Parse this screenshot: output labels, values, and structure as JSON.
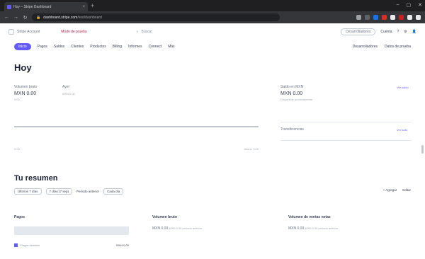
{
  "browser": {
    "tab_title": "Hoy – Stripe Dashboard",
    "url_host": "dashboard.stripe.com",
    "url_path": "/test/dashboard",
    "new_tab": "+",
    "controls": [
      "–",
      "▢",
      "✕"
    ]
  },
  "topbar": {
    "account": "Stripe Account",
    "test_mode": "Modo de prueba",
    "search_placeholder": "Buscar",
    "dev_pill": "Desarrolladores",
    "account_label": "Cuenta"
  },
  "nav": {
    "items": [
      "Inicio",
      "Pagos",
      "Saldos",
      "Clientes",
      "Productos",
      "Billing",
      "Informes",
      "Connect",
      "Más"
    ],
    "right": [
      "Desarrolladores",
      "Datos de prueba"
    ]
  },
  "page_title": "Hoy",
  "stats": {
    "gross": {
      "label": "Volumen bruto",
      "value": "MXN 0.00",
      "sub": "0:00"
    },
    "yesterday": {
      "label": "Ayer",
      "value": "",
      "sub": "MXN 0.00"
    },
    "balance": {
      "label": "Saldo en MXN",
      "value": "MXN 0.00",
      "sub": "Disponible próximamente",
      "link": "Ver saldo"
    },
    "payouts": {
      "label": "Transferencias",
      "link": "Ver todo"
    }
  },
  "chart": {
    "left_label": "0:00",
    "right_label": "Ahora, 0:00"
  },
  "summary": {
    "title": "Tu resumen",
    "filters": [
      "Últimos 7 días",
      "7 días (7 sep)",
      "Periodo anterior",
      "Cada día"
    ],
    "actions": [
      "+ Agregar",
      "Editar"
    ]
  },
  "cards": {
    "payments": {
      "title": "Pagos"
    },
    "gross": {
      "title": "Volumen bruto",
      "value": "MXN 0.00",
      "compare": "MXN 0.00 periodo anterior"
    },
    "net": {
      "title": "Volumen de ventas netas",
      "value": "MXN 0.00",
      "compare": "MXN 0.00 periodo anterior"
    }
  },
  "legend": {
    "label": "Pagos exitosos",
    "amount": "MXN 0.00"
  },
  "colors": {
    "accent": "#635bff",
    "test_mode": "#c1264b"
  }
}
